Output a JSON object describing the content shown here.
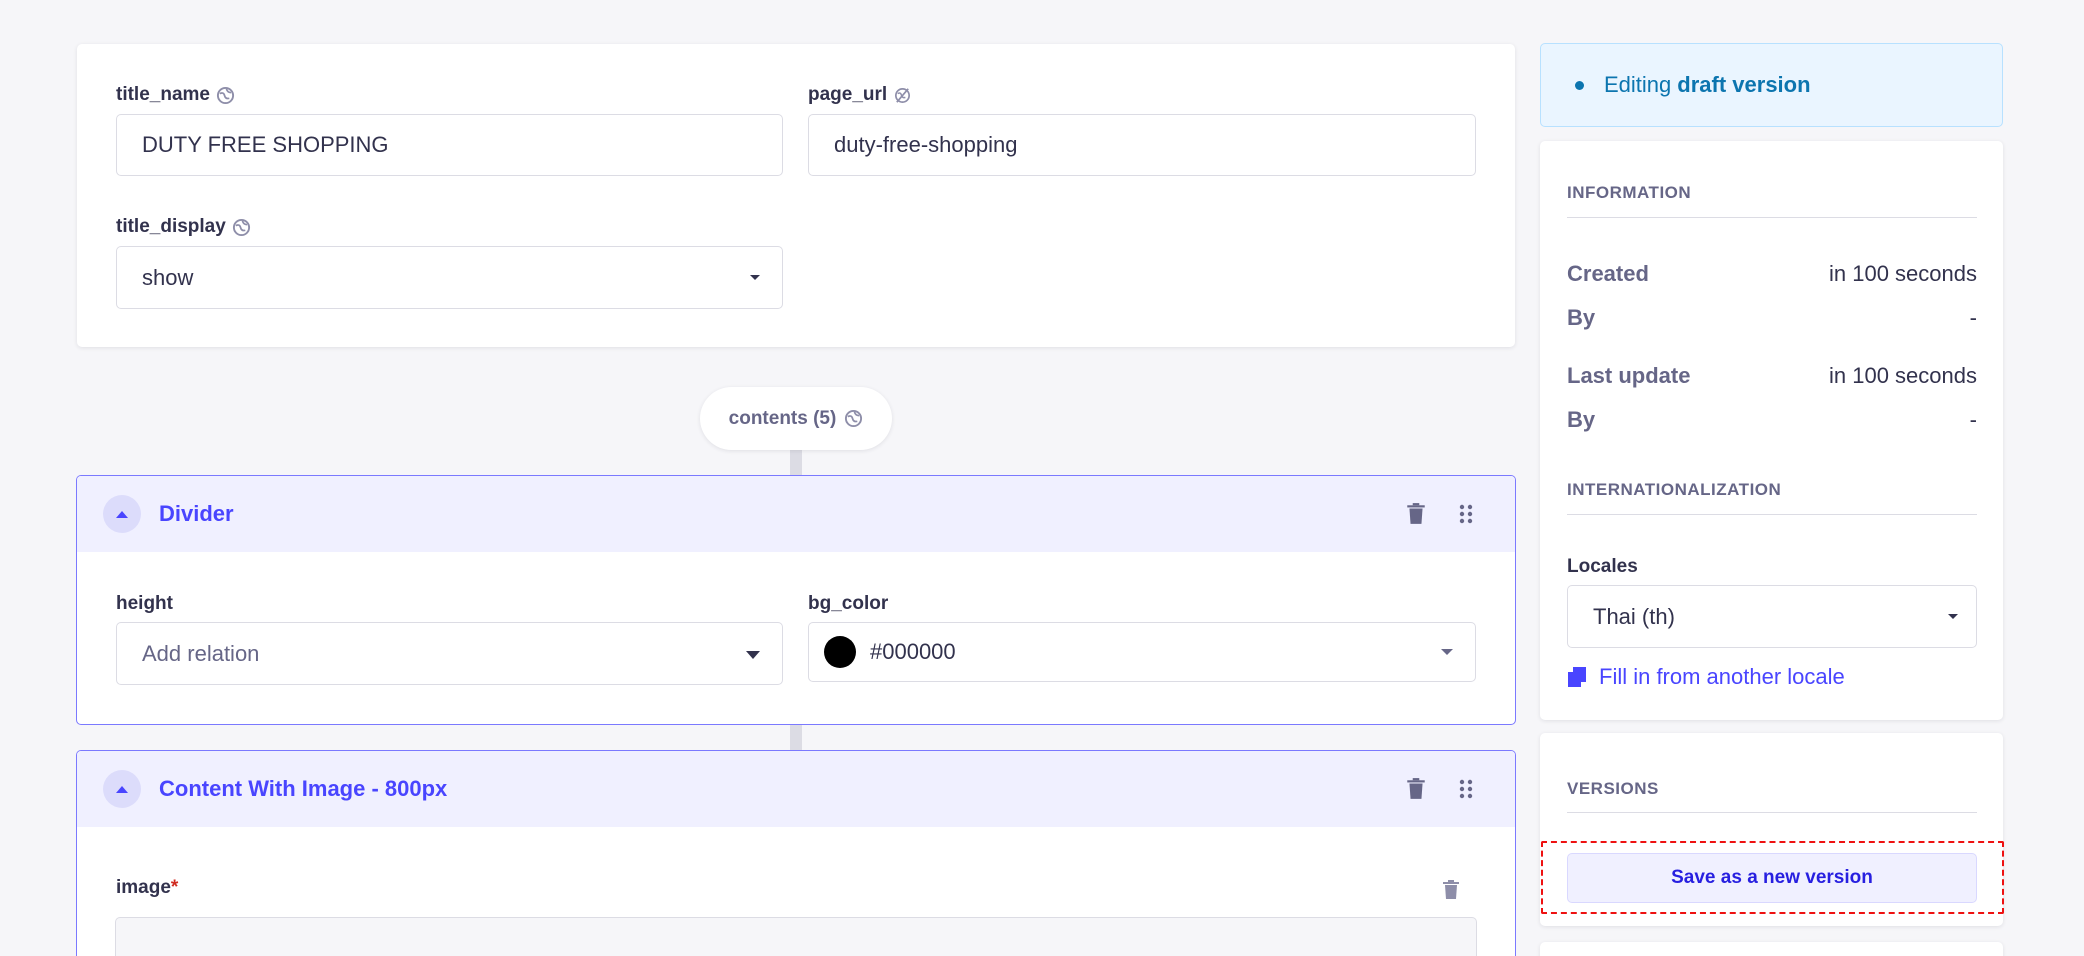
{
  "main_fields": {
    "title_name": {
      "label": "title_name",
      "value": "DUTY FREE SHOPPING"
    },
    "page_url": {
      "label": "page_url",
      "value": "duty-free-shopping"
    },
    "title_display": {
      "label": "title_display",
      "value": "show"
    }
  },
  "contents": {
    "label": "contents (5)"
  },
  "components": [
    {
      "title": "Divider",
      "fields": {
        "height": {
          "label": "height",
          "placeholder": "Add relation"
        },
        "bg_color": {
          "label": "bg_color",
          "value": "#000000",
          "swatch": "#000000"
        }
      }
    },
    {
      "title": "Content With Image - 800px",
      "fields": {
        "image": {
          "label": "image",
          "required_mark": "*"
        }
      }
    }
  ],
  "sidebar": {
    "status": {
      "prefix": "Editing",
      "emphasis": "draft version"
    },
    "information": {
      "title": "INFORMATION",
      "rows": [
        {
          "key": "Created",
          "value": "in 100 seconds"
        },
        {
          "key": "By",
          "value": "-"
        },
        {
          "key": "Last update",
          "value": "in 100 seconds"
        },
        {
          "key": "By",
          "value": "-"
        }
      ]
    },
    "internationalization": {
      "title": "INTERNATIONALIZATION",
      "locales_label": "Locales",
      "locale_value": "Thai (th)",
      "fill_link": "Fill in from another locale"
    },
    "versions": {
      "title": "VERSIONS",
      "save_button": "Save as a new version"
    }
  },
  "colors": {
    "accent": "#4945ff",
    "component_border": "#7b79ff",
    "component_header": "#f0f0ff",
    "status_bg": "#eaf5ff",
    "status_text": "#0c75af",
    "required": "#d02b20",
    "highlight_dashed": "#ee1111"
  },
  "icons": {
    "globe": "globe-icon",
    "globe_off": "globe-off-icon",
    "trash": "trash-icon",
    "drag": "drag-handle-icon",
    "caret": "caret-down-icon",
    "collapse": "chevron-up-icon",
    "duplicate": "duplicate-icon",
    "dot": "status-dot-icon"
  }
}
